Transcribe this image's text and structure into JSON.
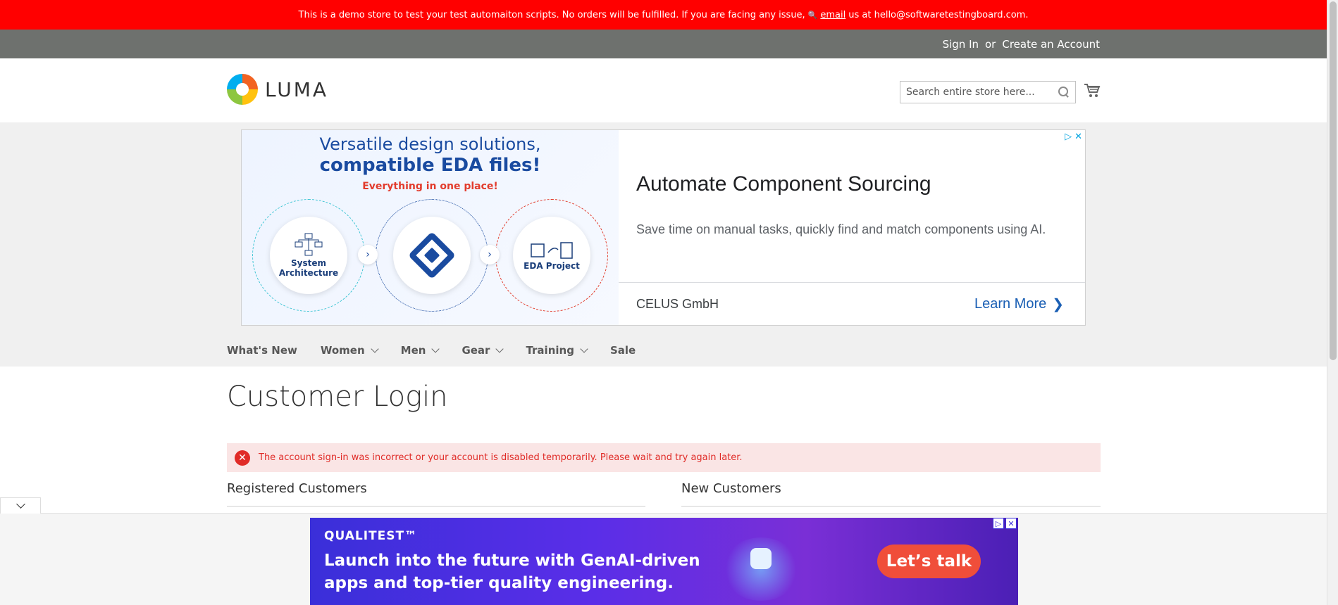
{
  "demo_banner": {
    "text_before": "This is a demo store to test your test automaiton scripts. No orders will be fulfilled. If you are facing any issue,",
    "icon": "magnifier-icon",
    "link": "email",
    "text_after": "us at hello@softwaretestingboard.com."
  },
  "top_links": {
    "sign_in": "Sign In",
    "or": "or",
    "create_account": "Create an Account"
  },
  "header": {
    "logo_text": "LUMA",
    "search_placeholder": "Search entire store here...",
    "cart_icon": "cart-icon"
  },
  "ad_top": {
    "headline_1": "Versatile design solutions,",
    "headline_2": "compatible EDA files!",
    "tagline": "Everything in one place!",
    "step_1": "System Architecture",
    "step_3": "EDA Project",
    "title": "Automate Component Sourcing",
    "description": "Save time on manual tasks, quickly find and match components using AI.",
    "advertiser": "CELUS GmbH",
    "cta": "Learn More",
    "adchoices_icons": [
      "adchoices-icon",
      "close-icon"
    ],
    "colors": {
      "primary": "#1a4ba0",
      "accent": "#e23b2c",
      "cta": "#1a5fb4"
    }
  },
  "nav": {
    "items": [
      {
        "label": "What's New",
        "has_dropdown": false
      },
      {
        "label": "Women",
        "has_dropdown": true
      },
      {
        "label": "Men",
        "has_dropdown": true
      },
      {
        "label": "Gear",
        "has_dropdown": true
      },
      {
        "label": "Training",
        "has_dropdown": true
      },
      {
        "label": "Sale",
        "has_dropdown": false
      }
    ]
  },
  "page": {
    "title": "Customer Login",
    "error_message": "The account sign-in was incorrect or your account is disabled temporarily. Please wait and try again later.",
    "registered_title": "Registered Customers",
    "new_title": "New Customers"
  },
  "ad_bottom": {
    "brand": "QUALITEST™",
    "line_1": "Launch into the future with GenAI-driven",
    "line_2": "apps and top-tier quality engineering.",
    "cta": "Let’s talk",
    "colors": {
      "cta": "#f04e3a",
      "background": "#5a2ee8"
    }
  },
  "colors": {
    "banner": "#ff0000",
    "topbar": "#6e716e",
    "error_bg": "#fae5e5",
    "error_text": "#e02b27"
  }
}
